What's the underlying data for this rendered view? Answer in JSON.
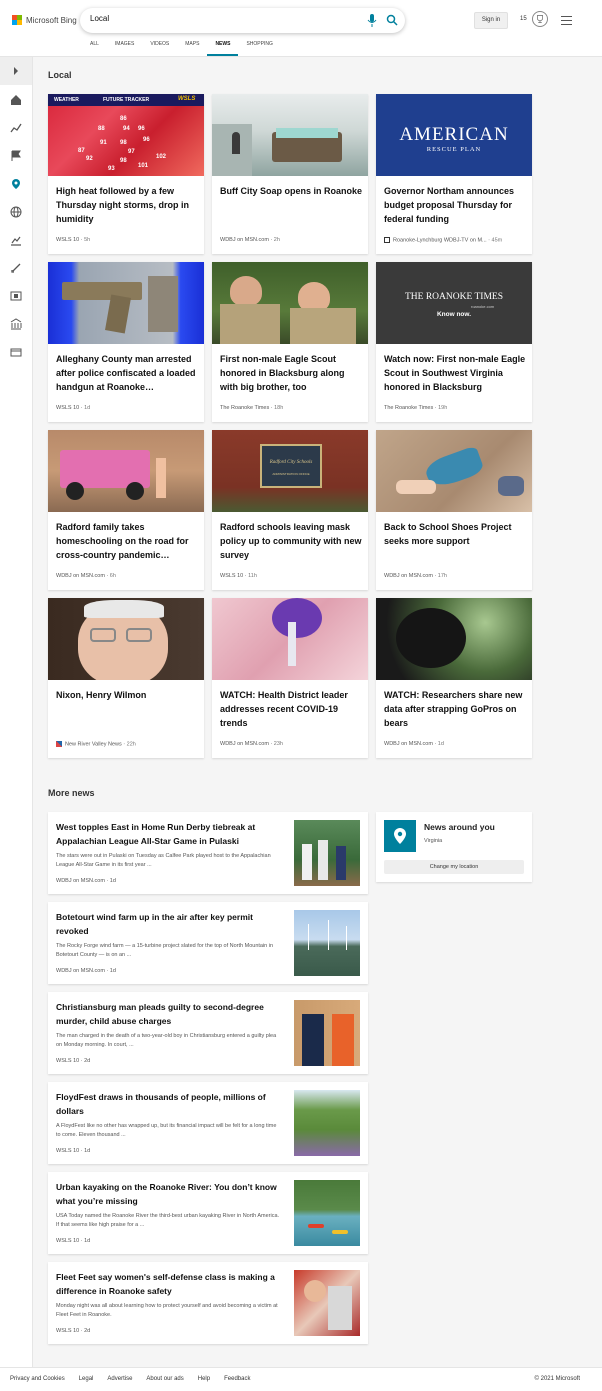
{
  "header": {
    "logo_text": "Microsoft Bing",
    "search_value": "Local",
    "signin_label": "Sign in",
    "points": "15",
    "tabs": [
      "ALL",
      "IMAGES",
      "VIDEOS",
      "MAPS",
      "NEWS",
      "SHOPPING"
    ],
    "active_tab": "NEWS"
  },
  "local": {
    "section_title": "Local",
    "cards": [
      {
        "title": "High heat followed by a few Thursday night storms, drop in humidity",
        "source": "WSLS 10",
        "time": "5h"
      },
      {
        "title": "Buff City Soap opens in Roanoke",
        "source": "WDBJ on MSN.com",
        "time": "2h"
      },
      {
        "title": "Governor Northam announces budget proposal Thursday for federal funding",
        "source": "Roanoke-Lynchburg WDBJ-TV on M...",
        "time": "45m"
      },
      {
        "title": "Alleghany County man arrested after police confiscated a loaded handgun at Roanoke…",
        "source": "WSLS 10",
        "time": "1d"
      },
      {
        "title": "First non-male Eagle Scout honored in Blacksburg along with big brother, too",
        "source": "The Roanoke Times",
        "time": "18h"
      },
      {
        "title": "Watch now: First non-male Eagle Scout in Southwest Virginia honored in Blacksburg",
        "source": "The Roanoke Times",
        "time": "19h"
      },
      {
        "title": "Radford family takes homeschooling on the road for cross-country pandemic…",
        "source": "WDBJ on MSN.com",
        "time": "6h"
      },
      {
        "title": "Radford schools leaving mask policy up to community with new survey",
        "source": "WSLS 10",
        "time": "11h"
      },
      {
        "title": "Back to School Shoes Project seeks more support",
        "source": "WDBJ on MSN.com",
        "time": "17h"
      },
      {
        "title": "Nixon, Henry Wilmon",
        "source": "New River Valley News",
        "time": "22h"
      },
      {
        "title": "WATCH: Health District leader addresses recent COVID-19 trends",
        "source": "WDBJ on MSN.com",
        "time": "23h"
      },
      {
        "title": "WATCH: Researchers share new data after strapping GoPros on bears",
        "source": "WDBJ on MSN.com",
        "time": "1d"
      }
    ],
    "weather_img": {
      "label1": "WEATHER",
      "label2": "FUTURE TRACKER",
      "label3": "WSLS",
      "temps": [
        "86",
        "88",
        "94",
        "96",
        "87",
        "91",
        "98",
        "96",
        "97",
        "92",
        "102",
        "98",
        "101",
        "93"
      ]
    },
    "arp_img": {
      "line1": "AMERICAN",
      "line2": "RESCUE PLAN"
    },
    "rt_img": {
      "line1": "THE ROANOKE TIMES",
      "line2": "roanoke.com",
      "line3": "Know now."
    },
    "school_sign": {
      "line1": "Radford City Schools",
      "line2": "ADMINISTRATION OFFICE"
    }
  },
  "more_news": {
    "section_title": "More news",
    "items": [
      {
        "title": "West topples East in Home Run Derby tiebreak at Appalachian League All-Star Game in Pulaski",
        "snippet": "The stars were out in Pulaski on Tuesday as Calfee Park played host to the Appalachian League All-Star Game in its first year ...",
        "source": "WDBJ on MSN.com",
        "time": "1d"
      },
      {
        "title": "Botetourt wind farm up in the air after key permit revoked",
        "snippet": "The Rocky Forge wind farm — a 15-turbine project slated for the top of North Mountain in Botetourt County — is on an ...",
        "source": "WDBJ on MSN.com",
        "time": "1d"
      },
      {
        "title": "Christiansburg man pleads guilty to second-degree murder, child abuse charges",
        "snippet": "The man charged in the death of a two-year-old boy in Christiansburg entered a guilty plea on Monday morning. In court, ...",
        "source": "WSLS 10",
        "time": "2d"
      },
      {
        "title": "FloydFest draws in thousands of people, millions of dollars",
        "snippet": "A FloydFest like no other has wrapped up, but its financial impact will be felt for a long time to come. Eleven thousand ...",
        "source": "WSLS 10",
        "time": "1d"
      },
      {
        "title": "Urban kayaking on the Roanoke River: You don’t know what you’re missing",
        "snippet": "USA Today named the Roanoke River the third-best urban kayaking River in North America. If that seems like high praise for a ...",
        "source": "WSLS 10",
        "time": "1d"
      },
      {
        "title": "Fleet Feet say women's self-defense class is making a difference in Roanoke safety",
        "snippet": "Monday night was all about learning how to protect yourself and avoid becoming a victim at Fleet Feet in Roanoke.",
        "source": "WSLS 10",
        "time": "2d"
      }
    ]
  },
  "news_around_you": {
    "title": "News around you",
    "location": "Virginia",
    "button_label": "Change my location"
  },
  "footer": {
    "links": [
      "Privacy and Cookies",
      "Legal",
      "Advertise",
      "About our ads",
      "Help",
      "Feedback"
    ],
    "copyright": "© 2021 Microsoft"
  },
  "colors": {
    "accent": "#00809d",
    "background": "#f5f5f5",
    "card": "#ffffff"
  }
}
